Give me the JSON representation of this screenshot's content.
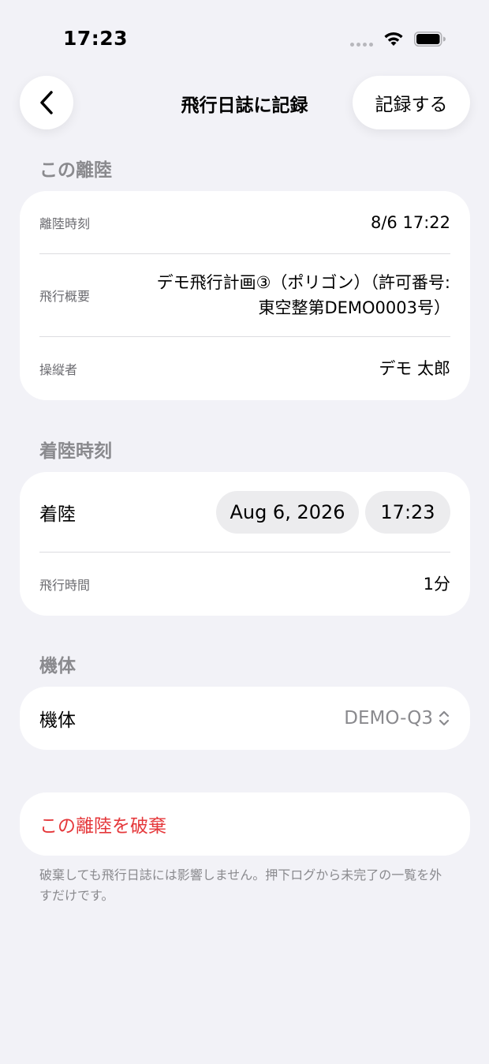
{
  "status_bar": {
    "time": "17:23"
  },
  "nav": {
    "title": "飛行日誌に記録",
    "save_label": "記録する"
  },
  "takeoff_section": {
    "header": "この離陸",
    "rows": [
      {
        "label": "離陸時刻",
        "value": "8/6 17:22"
      },
      {
        "label": "飛行概要",
        "value_line1": "デモ飛行計画③（ポリゴン）（許可番号:",
        "value_line2": "東空整第DEMO0003号）"
      },
      {
        "label": "操縦者",
        "value": "デモ 太郎"
      }
    ]
  },
  "landing_section": {
    "header": "着陸時刻",
    "landing_label": "着陸",
    "date": "Aug 6, 2026",
    "time": "17:23",
    "duration_label": "飛行時間",
    "duration_value": "1分"
  },
  "aircraft_section": {
    "header": "機体",
    "label": "機体",
    "selected": "DEMO-Q3"
  },
  "discard": {
    "label": "この離陸を破棄",
    "footnote": "破棄しても飛行日誌には影響しません。押下ログから未完了の一覧を外すだけです。"
  },
  "colors": {
    "background": "#f2f2f7",
    "destructive": "#e5383b",
    "secondary_text": "#8a8a8e"
  }
}
